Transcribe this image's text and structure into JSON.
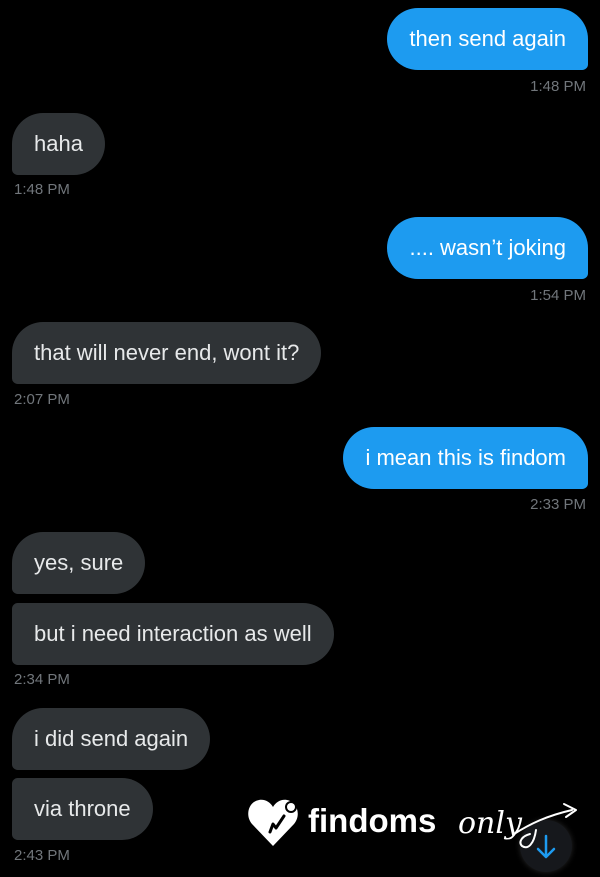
{
  "messages": [
    {
      "dir": "out",
      "text": "then send again",
      "time": "1:48 PM"
    },
    {
      "dir": "in",
      "text": "haha",
      "time": "1:48 PM"
    },
    {
      "dir": "out",
      "text": ".... wasn’t joking",
      "time": "1:54 PM"
    },
    {
      "dir": "in",
      "text": "that will never end, wont it?",
      "time": "2:07 PM"
    },
    {
      "dir": "out",
      "text": "i mean this is findom",
      "time": "2:33 PM"
    },
    {
      "dir": "in",
      "text": "yes, sure",
      "time": ""
    },
    {
      "dir": "in",
      "text": "but i need interaction as well",
      "time": "2:34 PM"
    },
    {
      "dir": "in",
      "text": "i did send again",
      "time": ""
    },
    {
      "dir": "in",
      "text": "via throne",
      "time": "2:43 PM"
    }
  ],
  "watermark": {
    "brand": "findoms",
    "script": "only",
    "icon": "heart-icon"
  },
  "scroll_button": {
    "icon": "arrow-down-icon"
  },
  "colors": {
    "outgoing_bubble": "#1d9bf0",
    "incoming_bubble": "#2f3336",
    "timestamp": "#71767b",
    "background": "#000000"
  }
}
